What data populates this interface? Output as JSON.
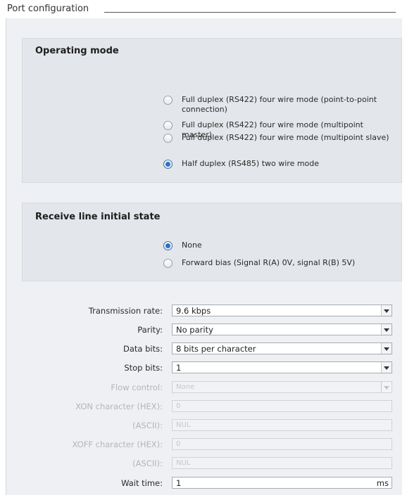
{
  "header": {
    "title": "Port configuration"
  },
  "operating_mode": {
    "title": "Operating mode",
    "options": [
      {
        "label": "Full duplex (RS422) four wire mode (point-to-point connection)",
        "checked": false
      },
      {
        "label": "Full duplex (RS422) four wire mode (multipoint master)",
        "checked": false
      },
      {
        "label": "Full duplex (RS422) four wire mode (multipoint slave)",
        "checked": false
      },
      {
        "label": "Half duplex (RS485) two wire mode",
        "checked": true
      }
    ]
  },
  "receive_line": {
    "title": "Receive line initial state",
    "options": [
      {
        "label": "None",
        "checked": true
      },
      {
        "label": "Forward bias (Signal R(A) 0V, signal R(B) 5V)",
        "checked": false
      }
    ]
  },
  "fields": {
    "transmission_rate": {
      "label": "Transmission rate:",
      "value": "9.6 kbps"
    },
    "parity": {
      "label": "Parity:",
      "value": "No parity"
    },
    "data_bits": {
      "label": "Data bits:",
      "value": "8 bits per character"
    },
    "stop_bits": {
      "label": "Stop bits:",
      "value": "1"
    },
    "flow_control": {
      "label": "Flow control:",
      "value": "None"
    },
    "xon_hex": {
      "label": "XON character (HEX):",
      "value": "0"
    },
    "xon_ascii": {
      "label": "(ASCII):",
      "value": "NUL"
    },
    "xoff_hex": {
      "label": "XOFF character (HEX):",
      "value": "0"
    },
    "xoff_ascii": {
      "label": "(ASCII):",
      "value": "NUL"
    },
    "wait_time": {
      "label": "Wait time:",
      "value": "1",
      "unit": "ms"
    }
  }
}
